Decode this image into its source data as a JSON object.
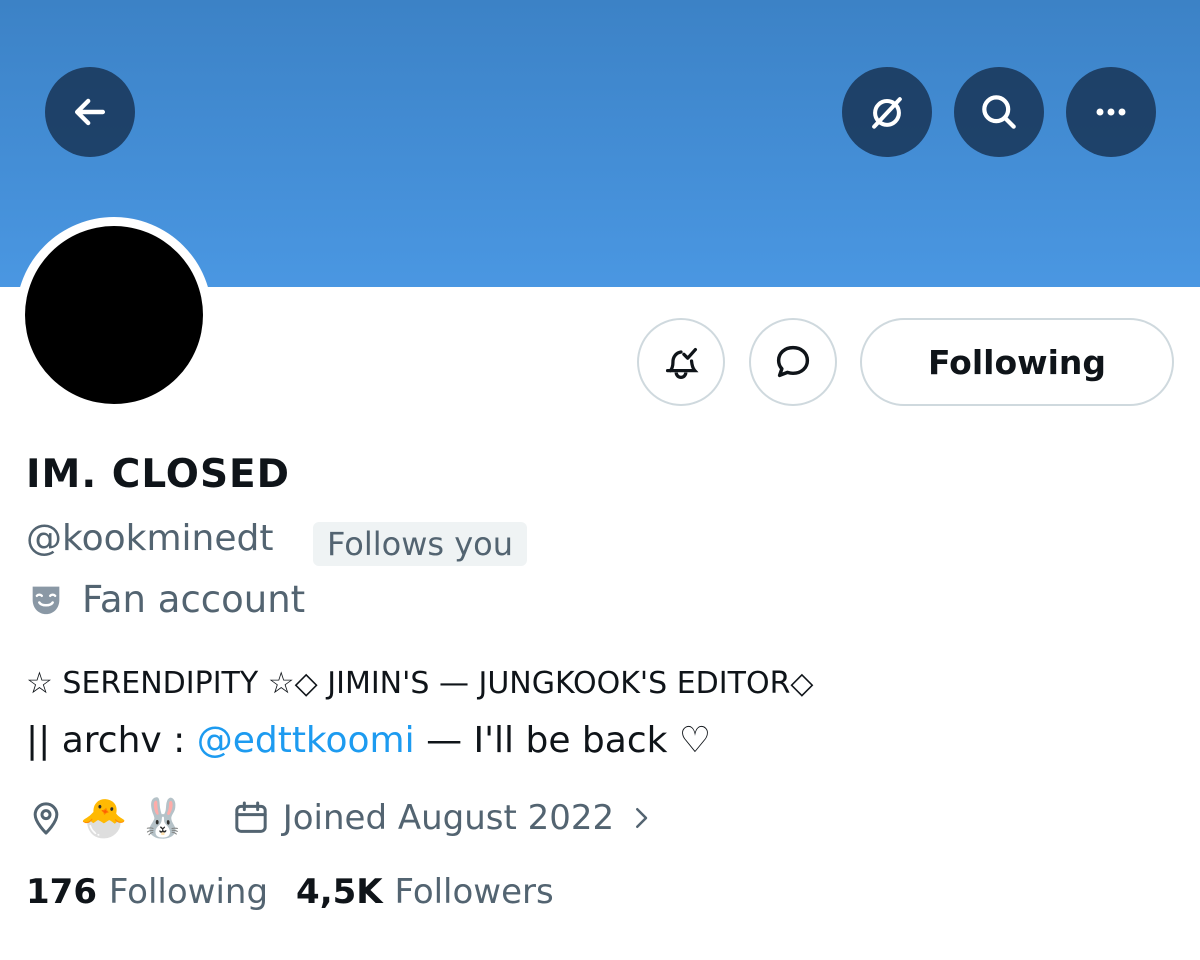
{
  "header": {
    "back_icon": "arrow-left-icon",
    "grok_icon": "grok-slash-icon",
    "search_icon": "search-icon",
    "more_icon": "more-dots-icon",
    "banner_color": "#4a97e2"
  },
  "actions": {
    "notify_icon": "bell-check-icon",
    "message_icon": "message-bubble-icon",
    "following_label": "Following"
  },
  "profile": {
    "display_name": "IM. CLOSED",
    "handle": "@kookminedt",
    "follows_you": "Follows you",
    "category": "Fan account",
    "bio_line1": "☆ SERENDIPITY ☆◇ JIMIN'S — JUNGKOOK'S EDITOR◇",
    "bio_line2_prefix": "|| archv : ",
    "bio_line2_link": "@edttkoomi",
    "bio_line2_suffix": " — I'll be back ♡",
    "location": "🐣 🐰",
    "joined": "Joined August 2022"
  },
  "stats": {
    "following_count": "176",
    "following_label": "Following",
    "followers_count": "4,5K",
    "followers_label": "Followers"
  },
  "colors": {
    "link": "#1d9bf0",
    "secondary_text": "#536471",
    "primary_text": "#0f1419"
  }
}
